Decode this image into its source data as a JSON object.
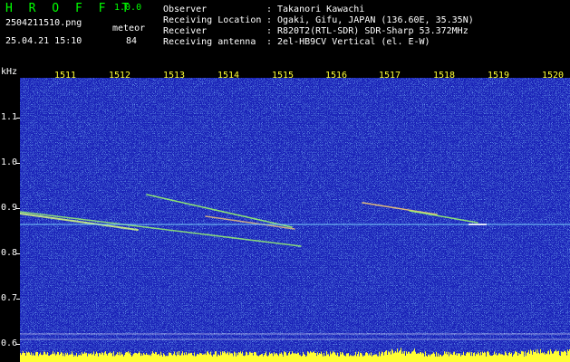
{
  "header": {
    "logo": "H R O F F T",
    "version": "1.0.0",
    "filename": "2504211510.png",
    "datetime": "25.04.21 15:10",
    "meteor_label": "meteor",
    "meteor_count": "84",
    "fields": [
      {
        "label": "Observer",
        "sep": ":",
        "value": "Takanori Kawachi"
      },
      {
        "label": "Receiving Location",
        "sep": ":",
        "value": "Ogaki, Gifu, JAPAN (136.60E, 35.35N)"
      },
      {
        "label": "Receiver",
        "sep": ":",
        "value": "R820T2(RTL-SDR) SDR-Sharp 53.372MHz"
      },
      {
        "label": "Receiving antenna",
        "sep": ":",
        "value": "2el-HB9CV Vertical (el. E-W)"
      }
    ]
  },
  "axes": {
    "y_unit": "kHz",
    "x_ticks": [
      "1511",
      "1512",
      "1513",
      "1514",
      "1515",
      "1516",
      "1517",
      "1518",
      "1519",
      "1520"
    ],
    "y_ticks": [
      "1.1",
      "1.0",
      "0.9",
      "0.8",
      "0.7",
      "0.6"
    ]
  },
  "colors": {
    "background": "#1a22b8",
    "noise": "#3fa0ff",
    "trail": "#9eff6a",
    "signal": "#ffff33",
    "grid": "#ffffff"
  }
}
